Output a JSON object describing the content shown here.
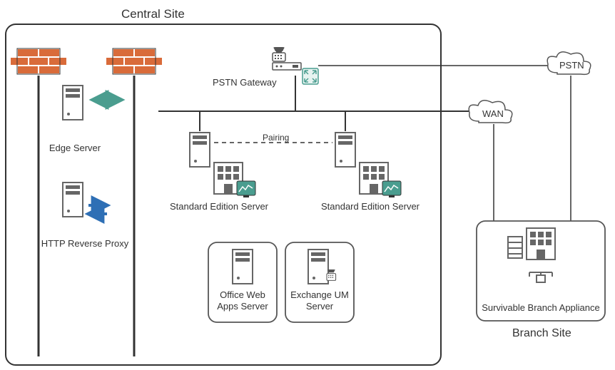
{
  "titles": {
    "central_site": "Central Site",
    "branch_site": "Branch Site"
  },
  "labels": {
    "edge_server": "Edge Server",
    "http_reverse_proxy": "HTTP Reverse Proxy",
    "pstn_gateway": "PSTN Gateway",
    "pairing": "Pairing",
    "standard_edition_server_1": "Standard Edition Server",
    "standard_edition_server_2": "Standard Edition Server",
    "office_web_apps_server": "Office Web\nApps Server",
    "exchange_um_server": "Exchange UM\nServer",
    "survivable_branch_appliance": "Survivable Branch Appliance",
    "pstn": "PSTN",
    "wan": "WAN"
  },
  "icons": {
    "firewall": "firewall",
    "server": "server",
    "arrows_bi": "bi-arrows",
    "arrows_swap": "swap-arrows",
    "phone": "phone",
    "device": "device",
    "fullscreen": "fullscreen",
    "building": "building",
    "monitor": "monitor",
    "cloud": "cloud",
    "rack": "rack"
  },
  "colors": {
    "line": "#333333",
    "brick": "#d96b3a",
    "gray": "#666666",
    "teal": "#4a9d8f",
    "blue": "#2e6fb5",
    "box_border": "#555555"
  }
}
